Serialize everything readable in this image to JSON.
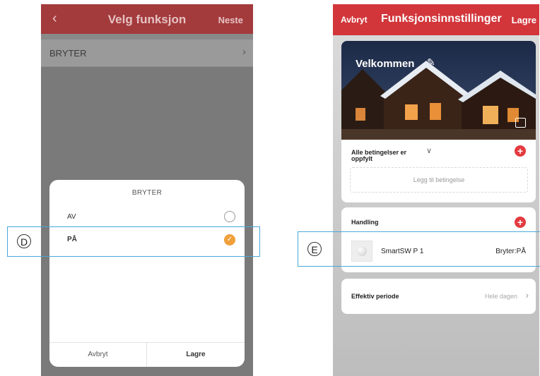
{
  "phone1": {
    "header": {
      "back_icon": "chevron-left-icon",
      "title": "Velg funksjon",
      "next_label": "Neste"
    },
    "row": {
      "label": "BRYTER"
    },
    "sheet": {
      "title": "BRYTER",
      "options": [
        {
          "label": "AV",
          "selected": false
        },
        {
          "label": "PÅ",
          "selected": true
        }
      ],
      "cancel_label": "Avbryt",
      "save_label": "Lagre"
    }
  },
  "phone2": {
    "header": {
      "cancel_label": "Avbryt",
      "title": "Funksjonsinnstillinger",
      "save_label": "Lagre"
    },
    "scene": {
      "name": "Velkommen"
    },
    "conditions": {
      "label": "Alle betingelser er oppfylt",
      "add_label": "Legg til betingelse"
    },
    "action": {
      "title": "Handling",
      "device_name": "SmartSW P 1",
      "device_value": "Bryter:PÅ"
    },
    "period": {
      "label": "Effektiv periode",
      "value": "Hele dagen"
    }
  },
  "callouts": {
    "d": "D",
    "e": "E"
  },
  "colors": {
    "header_red": "#d2363b",
    "dimmed_header": "#a33a3c",
    "check_orange": "#f0a03a",
    "callout_blue": "#4aa8d8"
  }
}
